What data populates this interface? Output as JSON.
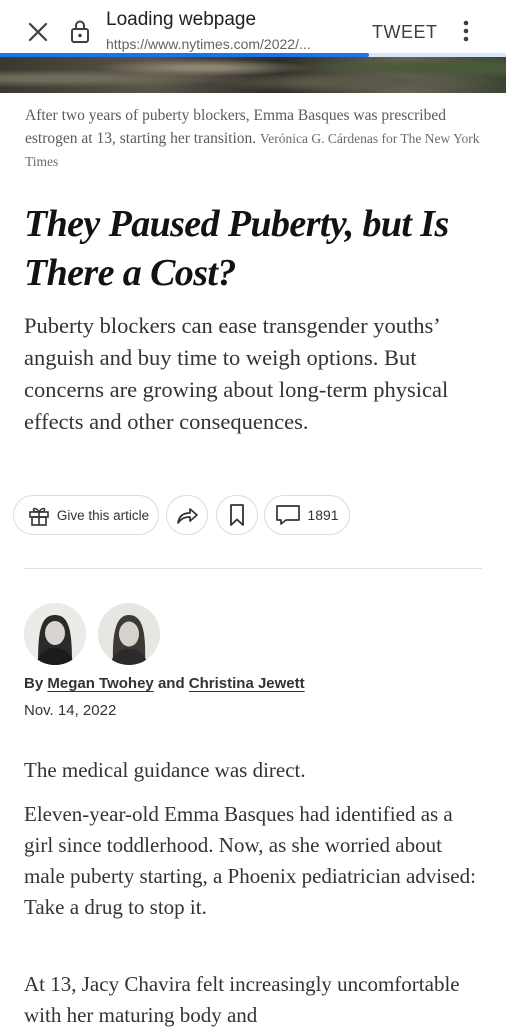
{
  "browser": {
    "title": "Loading webpage",
    "url": "https://www.nytimes.com/2022/...",
    "tweet_label": "TWEET",
    "loading_progress": 0.73,
    "accent_color": "#1a73e8",
    "icons": [
      "close-icon",
      "lock-icon",
      "more-vertical-icon"
    ]
  },
  "article": {
    "caption": "After two years of puberty blockers, Emma Basques was prescribed estrogen at 13, starting her transition.",
    "credit": "Verónica G. Cárdenas for The New York Times",
    "headline": "They Paused Puberty, but Is There a Cost?",
    "summary": "Puberty blockers can ease transgender youths’ anguish and buy time to weigh options. But concerns are growing about long-term physical effects and other consequences.",
    "actions": {
      "gift_label": "Give this article",
      "comments_count": "1891",
      "icons": [
        "gift-icon",
        "share-icon",
        "bookmark-icon",
        "comment-icon"
      ]
    },
    "byline": {
      "prefix": "By",
      "author1": "Megan Twohey",
      "conjunction": "and",
      "author2": "Christina Jewett"
    },
    "date": "Nov. 14, 2022",
    "paragraphs": [
      "The medical guidance was direct.",
      "Eleven-year-old Emma Basques had identified as a girl since toddlerhood. Now, as she worried about male puberty starting, a Phoenix pediatrician advised: Take a drug to stop it.",
      "At 13, Jacy Chavira felt increasingly uncomfortable with her maturing body and"
    ]
  }
}
